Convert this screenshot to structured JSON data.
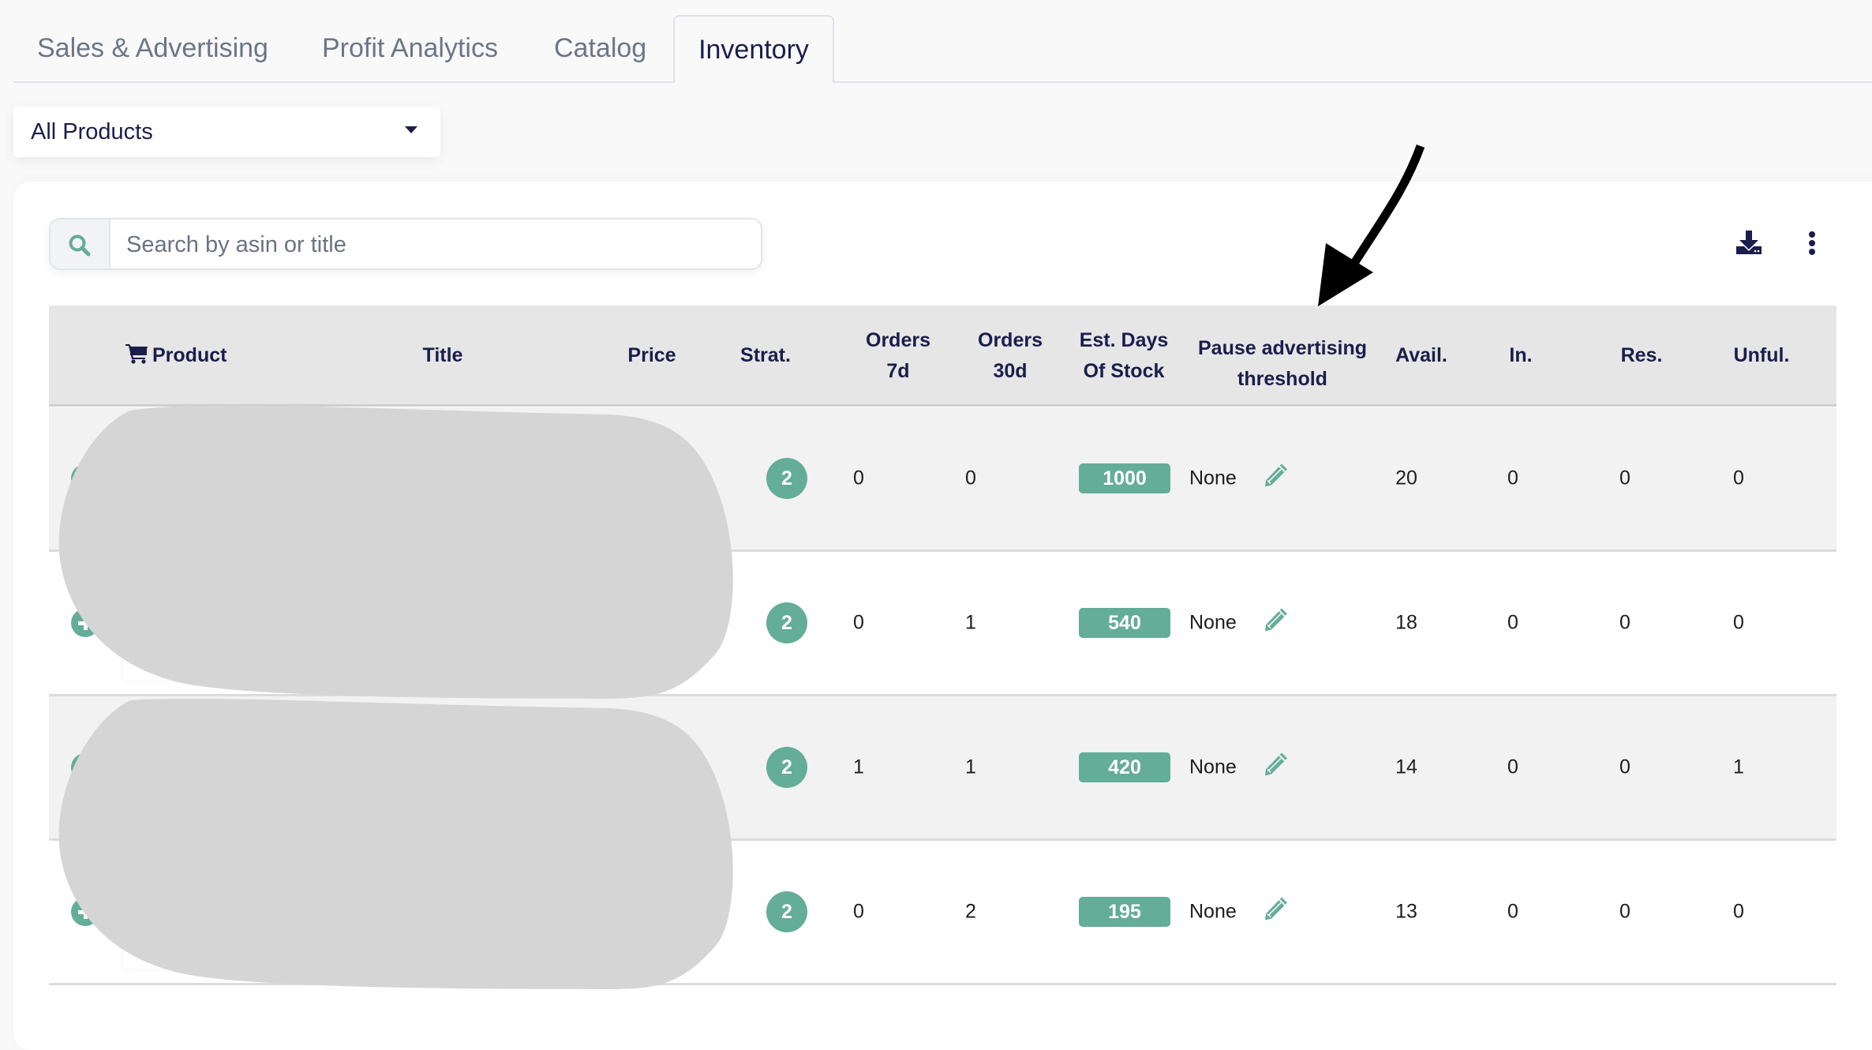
{
  "tabs": [
    {
      "label": "Sales & Advertising",
      "active": false
    },
    {
      "label": "Profit Analytics",
      "active": false
    },
    {
      "label": "Catalog",
      "active": false
    },
    {
      "label": "Inventory",
      "active": true
    }
  ],
  "product_filter": {
    "selected": "All Products"
  },
  "search": {
    "placeholder": "Search by asin or title",
    "value": "",
    "icon": "search-icon"
  },
  "toolbar": {
    "download_icon": "download-icon",
    "more_icon": "kebab-menu-icon"
  },
  "colors": {
    "accent": "#64ad97",
    "text_dark": "#1b1d4b",
    "header_bg": "#e6e6e6",
    "redaction": "#d5d5d5"
  },
  "table": {
    "headers": {
      "product": "Product",
      "title": "Title",
      "price": "Price",
      "strat": "Strat.",
      "orders_7d": [
        "Orders",
        "7d"
      ],
      "orders_30d": [
        "Orders",
        "30d"
      ],
      "est_days": [
        "Est. Days",
        "Of Stock"
      ],
      "pause_threshold": [
        "Pause advertising",
        "threshold"
      ],
      "avail": "Avail.",
      "inbound": "In.",
      "reserved": "Res.",
      "unfulfillable": "Unful."
    },
    "rows": [
      {
        "strat": "2",
        "orders_7d": "0",
        "orders_30d": "0",
        "est_days": "1000",
        "pause_threshold": "None",
        "avail": "20",
        "inbound": "0",
        "reserved": "0",
        "unfulfillable": "0"
      },
      {
        "strat": "2",
        "orders_7d": "0",
        "orders_30d": "1",
        "est_days": "540",
        "pause_threshold": "None",
        "avail": "18",
        "inbound": "0",
        "reserved": "0",
        "unfulfillable": "0"
      },
      {
        "strat": "2",
        "orders_7d": "1",
        "orders_30d": "1",
        "est_days": "420",
        "pause_threshold": "None",
        "avail": "14",
        "inbound": "0",
        "reserved": "0",
        "unfulfillable": "1"
      },
      {
        "strat": "2",
        "orders_7d": "0",
        "orders_30d": "2",
        "est_days": "195",
        "pause_threshold": "None",
        "avail": "13",
        "inbound": "0",
        "reserved": "0",
        "unfulfillable": "0"
      }
    ]
  },
  "annotation": {
    "type": "arrow",
    "points_to": "Pause advertising threshold"
  }
}
